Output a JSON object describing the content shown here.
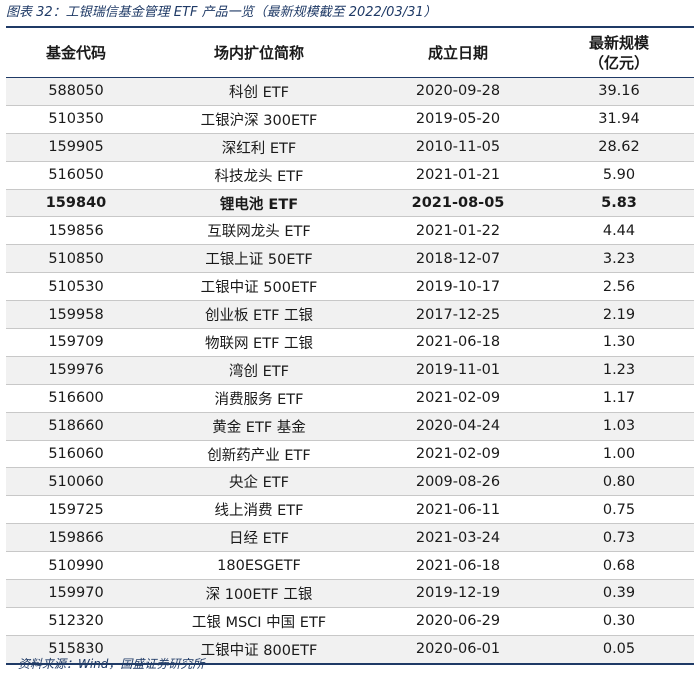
{
  "caption": "图表 32：工银瑞信基金管理 ETF 产品一览（最新规模截至 2022/03/31）",
  "headers": {
    "code": "基金代码",
    "name": "场内扩位简称",
    "date": "成立日期",
    "size_line1": "最新规模",
    "size_line2": "（亿元）"
  },
  "rows": [
    {
      "code": "588050",
      "name": "科创 ETF",
      "date": "2020-09-28",
      "size": "39.16"
    },
    {
      "code": "510350",
      "name": "工银沪深 300ETF",
      "date": "2019-05-20",
      "size": "31.94"
    },
    {
      "code": "159905",
      "name": "深红利 ETF",
      "date": "2010-11-05",
      "size": "28.62"
    },
    {
      "code": "516050",
      "name": "科技龙头 ETF",
      "date": "2021-01-21",
      "size": "5.90"
    },
    {
      "code": "159840",
      "name": "锂电池 ETF",
      "date": "2021-08-05",
      "size": "5.83",
      "bold": true
    },
    {
      "code": "159856",
      "name": "互联网龙头 ETF",
      "date": "2021-01-22",
      "size": "4.44"
    },
    {
      "code": "510850",
      "name": "工银上证 50ETF",
      "date": "2018-12-07",
      "size": "3.23"
    },
    {
      "code": "510530",
      "name": "工银中证 500ETF",
      "date": "2019-10-17",
      "size": "2.56"
    },
    {
      "code": "159958",
      "name": "创业板 ETF 工银",
      "date": "2017-12-25",
      "size": "2.19"
    },
    {
      "code": "159709",
      "name": "物联网 ETF 工银",
      "date": "2021-06-18",
      "size": "1.30"
    },
    {
      "code": "159976",
      "name": "湾创 ETF",
      "date": "2019-11-01",
      "size": "1.23"
    },
    {
      "code": "516600",
      "name": "消费服务 ETF",
      "date": "2021-02-09",
      "size": "1.17"
    },
    {
      "code": "518660",
      "name": "黄金 ETF 基金",
      "date": "2020-04-24",
      "size": "1.03"
    },
    {
      "code": "516060",
      "name": "创新药产业 ETF",
      "date": "2021-02-09",
      "size": "1.00"
    },
    {
      "code": "510060",
      "name": "央企 ETF",
      "date": "2009-08-26",
      "size": "0.80"
    },
    {
      "code": "159725",
      "name": "线上消费 ETF",
      "date": "2021-06-11",
      "size": "0.75"
    },
    {
      "code": "159866",
      "name": "日经 ETF",
      "date": "2021-03-24",
      "size": "0.73"
    },
    {
      "code": "510990",
      "name": "180ESGETF",
      "date": "2021-06-18",
      "size": "0.68"
    },
    {
      "code": "159970",
      "name": "深 100ETF 工银",
      "date": "2019-12-19",
      "size": "0.39"
    },
    {
      "code": "512320",
      "name": "工银 MSCI 中国 ETF",
      "date": "2020-06-29",
      "size": "0.30"
    },
    {
      "code": "515830",
      "name": "工银中证 800ETF",
      "date": "2020-06-01",
      "size": "0.05"
    }
  ],
  "source": "资料来源：Wind，国盛证券研究所"
}
